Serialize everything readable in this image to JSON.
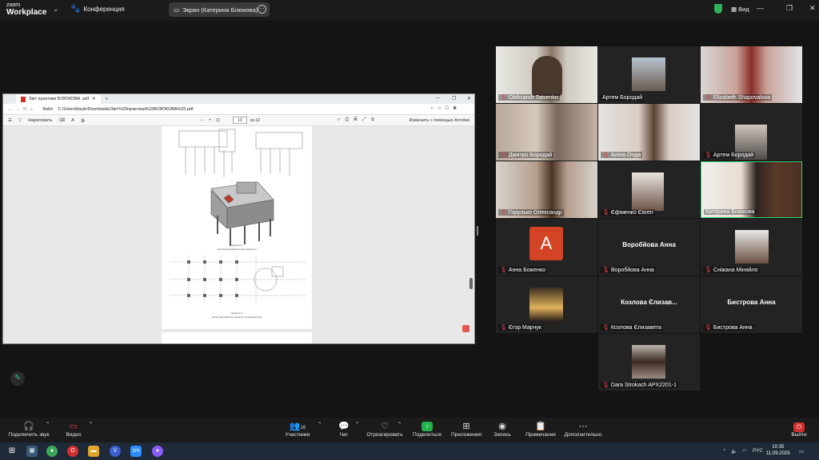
{
  "app": {
    "logo_top": "zoom",
    "logo_bottom": "Workplace",
    "meeting_label": "Конференция",
    "share_label": "Экран (Катерина Бізюкова)",
    "view_label": "Вид"
  },
  "pdf": {
    "tab_title": "Звіт практики БІЗЮКОВА .pdf",
    "file_label": "Файл",
    "url": "C:/Users/bizyk/Downloads/Звіт%20практики%20БІЗЮКОВА%20.pdf",
    "draw_label": "Нарисовать",
    "page_current": "10",
    "page_total": "из 12",
    "edit_label": "Изменить с помощью Acrobat",
    "caption1_line1": "Додаток 3",
    "caption1_line2": "(аксонометричні моделі каркасу)",
    "caption2_line1": "Додаток 4",
    "caption2_line2": "(план фундаменту каркасу та перекриття)"
  },
  "participants": [
    {
      "name": "Oleksandr Tatsenko",
      "muted": true
    },
    {
      "name": "Артем Бородай",
      "muted": false
    },
    {
      "name": "Elizabeth Shapovalova",
      "muted": true
    },
    {
      "name": "Дмитро Бородай",
      "muted": true
    },
    {
      "name": "Аліна Онда",
      "muted": true
    },
    {
      "name": "Артем Бородай",
      "muted": true
    },
    {
      "name": "Горулько Олександр",
      "muted": true
    },
    {
      "name": "Єфіменко Євген",
      "muted": true
    },
    {
      "name": "Катерина Бізюкова",
      "muted": false
    },
    {
      "name": "Анна Боженко",
      "muted": true,
      "avatar_letter": "A"
    },
    {
      "name": "Воробйова Анна",
      "muted": true,
      "big_name": "Воробйова Анна"
    },
    {
      "name": "Сніжана Міняйло",
      "muted": true
    },
    {
      "name": "Єгор Марчук",
      "muted": true
    },
    {
      "name": "Козлова Єлизавета",
      "muted": true,
      "big_name": "Козлова Єлизав..."
    },
    {
      "name": "Бистрова Анна",
      "muted": true,
      "big_name": "Бистрова Анна"
    },
    {
      "name": "Dara Strokach APX2201-1",
      "muted": true
    }
  ],
  "toolbar": {
    "audio": "Подключить звук",
    "video": "Видео",
    "participants": "Участники",
    "participants_count": "16",
    "chat": "Чат",
    "react": "Отреагировать",
    "share": "Поделиться",
    "apps": "Приложения",
    "record": "Запись",
    "notes": "Примечания",
    "more": "Дополнительно",
    "leave": "Выйти"
  },
  "taskbar": {
    "lang": "РУС",
    "time": "10:35",
    "date": "11.09.2025"
  },
  "colors": {
    "active_border": "#3ecf6b",
    "share_green": "#23b24c",
    "leave_red": "#d32f2f",
    "muted_red": "#e34747",
    "avatar_orange": "#d24423"
  }
}
